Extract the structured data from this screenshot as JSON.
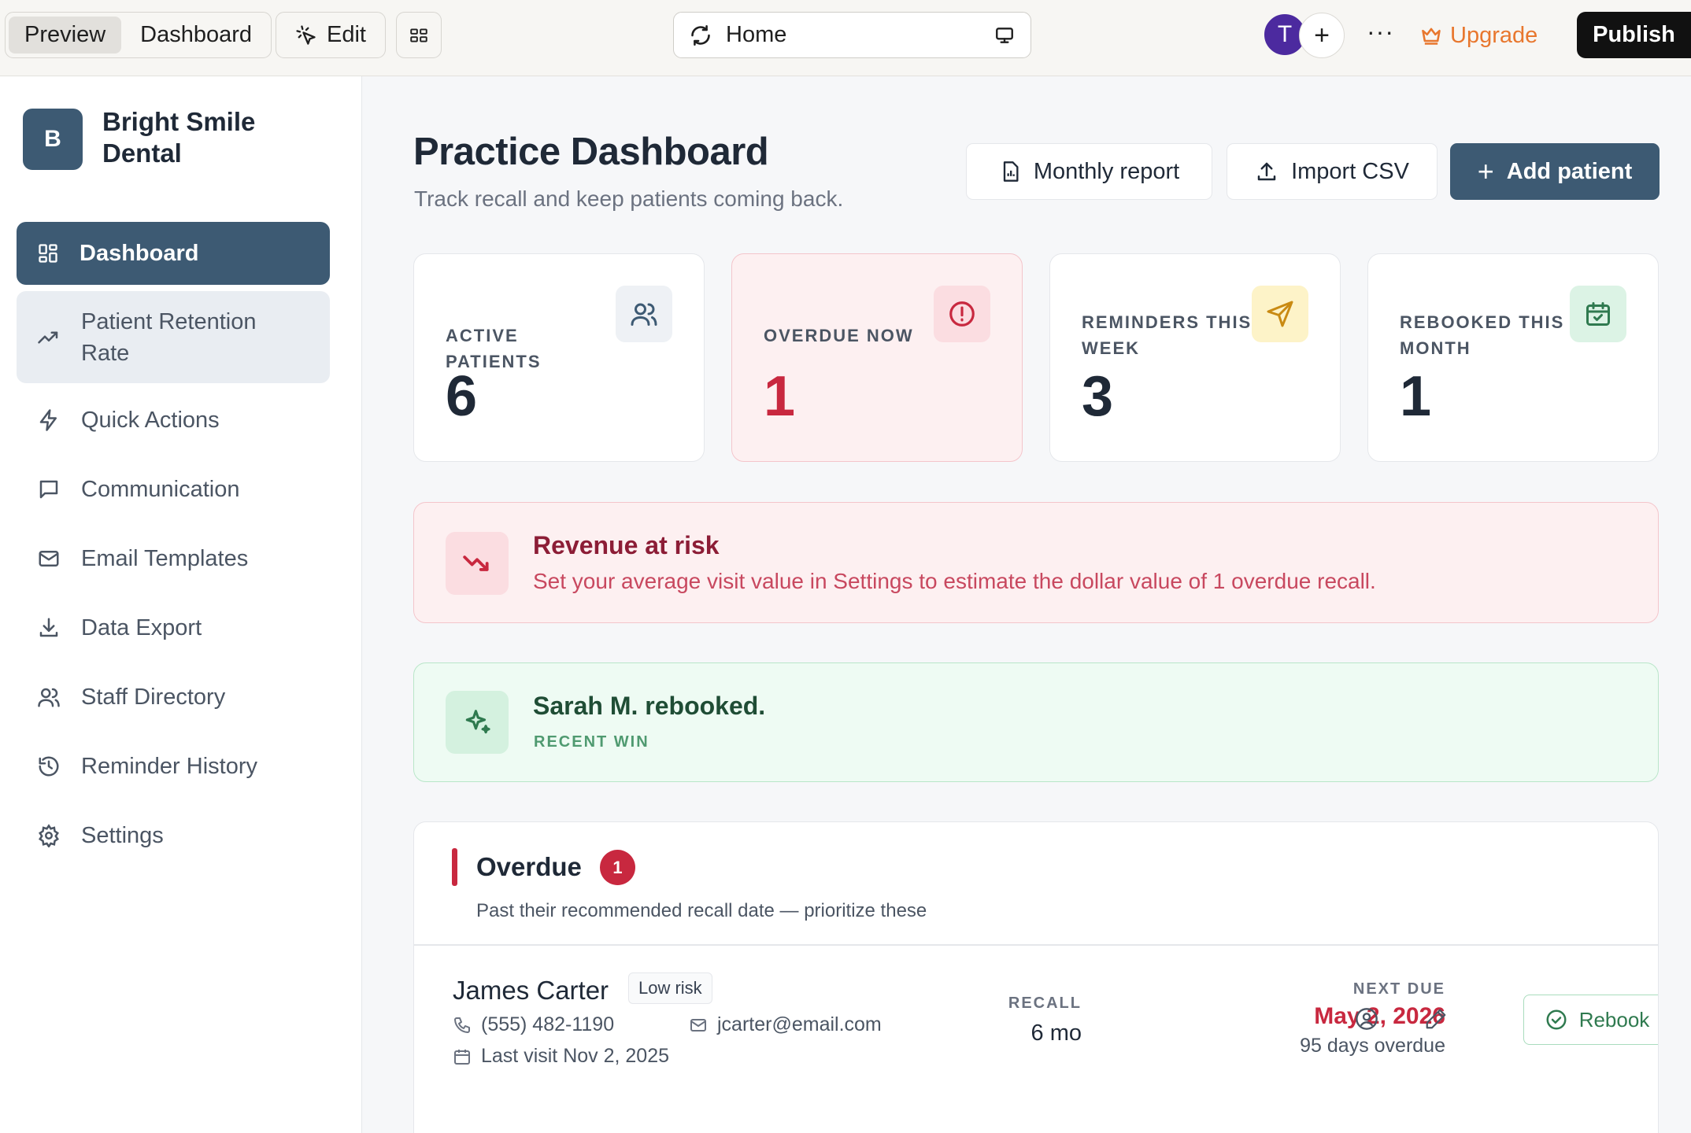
{
  "topbar": {
    "tabs": [
      {
        "label": "Preview"
      },
      {
        "label": "Dashboard"
      }
    ],
    "edit_label": "Edit",
    "url": "Home",
    "avatar_initial": "T",
    "upgrade_label": "Upgrade",
    "publish_label": "Publish"
  },
  "sidebar": {
    "logo_letter": "B",
    "brand_name": "Bright Smile Dental",
    "items": [
      {
        "label": "Dashboard",
        "icon": "grid-icon"
      },
      {
        "label": "Patient Retention Rate",
        "icon": "trending-up-icon"
      },
      {
        "label": "Quick Actions",
        "icon": "zap-icon"
      },
      {
        "label": "Communication",
        "icon": "message-icon"
      },
      {
        "label": "Email Templates",
        "icon": "mail-icon"
      },
      {
        "label": "Data Export",
        "icon": "download-icon"
      },
      {
        "label": "Staff Directory",
        "icon": "users-icon"
      },
      {
        "label": "Reminder History",
        "icon": "history-icon"
      },
      {
        "label": "Settings",
        "icon": "gear-icon"
      }
    ]
  },
  "header": {
    "title": "Practice Dashboard",
    "subtitle": "Track recall and keep patients coming back.",
    "monthly_report": "Monthly report",
    "import_csv": "Import CSV",
    "add_patient": "Add patient"
  },
  "stats": [
    {
      "label": "ACTIVE PATIENTS",
      "value": "6"
    },
    {
      "label": "OVERDUE NOW",
      "value": "1"
    },
    {
      "label": "REMINDERS THIS WEEK",
      "value": "3"
    },
    {
      "label": "REBOOKED THIS MONTH",
      "value": "1"
    }
  ],
  "revenue_banner": {
    "title": "Revenue at risk",
    "text": "Set your average visit value in Settings to estimate the dollar value of 1 overdue recall."
  },
  "win_banner": {
    "title": "Sarah M. rebooked.",
    "label": "RECENT WIN"
  },
  "overdue": {
    "title": "Overdue",
    "count": "1",
    "subtitle": "Past their recommended recall date — prioritize these",
    "patient": {
      "name": "James Carter",
      "risk": "Low risk",
      "phone": "(555) 482-1190",
      "email": "jcarter@email.com",
      "last_visit": "Last visit Nov 2, 2025",
      "recall_label": "RECALL",
      "recall_value": "6 mo",
      "next_due_label": "NEXT DUE",
      "next_due_date": "May 2, 2026",
      "overdue_text": "95 days overdue",
      "rebook_label": "Rebook"
    }
  },
  "colors": {
    "primary": "#3d5a73",
    "danger": "#c8283f",
    "success": "#2f7a4f",
    "upgrade": "#e8772e"
  }
}
